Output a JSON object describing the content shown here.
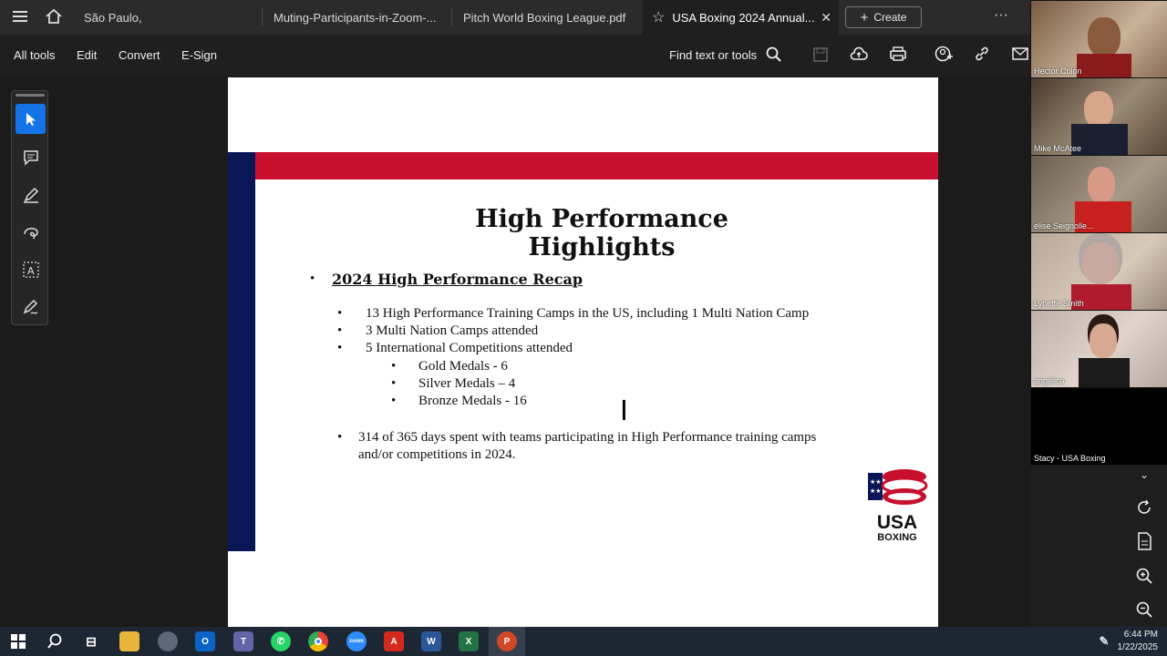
{
  "tabs": [
    {
      "label": "São Paulo,"
    },
    {
      "label": "Muting-Participants-in-Zoom-..."
    },
    {
      "label": "Pitch World Boxing League.pdf"
    },
    {
      "label": "USA Boxing 2024 Annual..."
    }
  ],
  "create_label": "Create",
  "toolbar": {
    "all_tools": "All tools",
    "edit": "Edit",
    "convert": "Convert",
    "esign": "E-Sign",
    "find": "Find text or tools"
  },
  "slide": {
    "title": "High Performance Highlights",
    "recap": "2024 High Performance Recap",
    "items": [
      "13 High Performance Training Camps in the US, including 1 Multi Nation Camp",
      "3 Multi Nation Camps attended",
      "5 International Competitions attended"
    ],
    "medals": [
      "Gold Medals - 6",
      "Silver Medals – 4",
      "Bronze Medals - 16"
    ],
    "days_line1": "314 of 365 days spent with teams participating in High Performance training camps",
    "days_line2": "and/or competitions in 2024.",
    "logo_text1": "USA",
    "logo_text2": "BOXING"
  },
  "participants": [
    {
      "name": "Hector Colón"
    },
    {
      "name": "Mike McAtee"
    },
    {
      "name": "elise Seignolle..."
    },
    {
      "name": "Lynette Smith"
    },
    {
      "name": "angelica"
    },
    {
      "name": "Stacy - USA Boxing"
    }
  ],
  "clock": {
    "time": "6:44 PM",
    "date": "1/22/2025"
  },
  "colors": {
    "accent": "#1473e6",
    "red": "#c8102e",
    "navy": "#0b1656"
  }
}
